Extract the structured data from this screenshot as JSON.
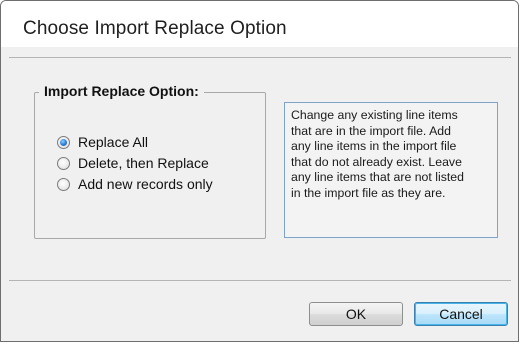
{
  "dialog": {
    "title": "Choose Import Replace Option"
  },
  "group": {
    "legend": "Import Replace Option:",
    "options": [
      {
        "label": "Replace All",
        "selected": true
      },
      {
        "label": "Delete, then Replace",
        "selected": false
      },
      {
        "label": "Add new records only",
        "selected": false
      }
    ]
  },
  "description": {
    "text": "Change any existing line items\nthat are in the import file.  Add\nany line items in the import file\nthat do not already exist.  Leave\nany line items that are not listed\nin the import file as they are."
  },
  "buttons": {
    "ok": "OK",
    "cancel": "Cancel"
  },
  "colors": {
    "dialog_bg": "#f0f0f0",
    "default_button_border": "#3c7fb1",
    "radio_selected": "#2a7ad6",
    "description_border": "#7fa3c8"
  }
}
